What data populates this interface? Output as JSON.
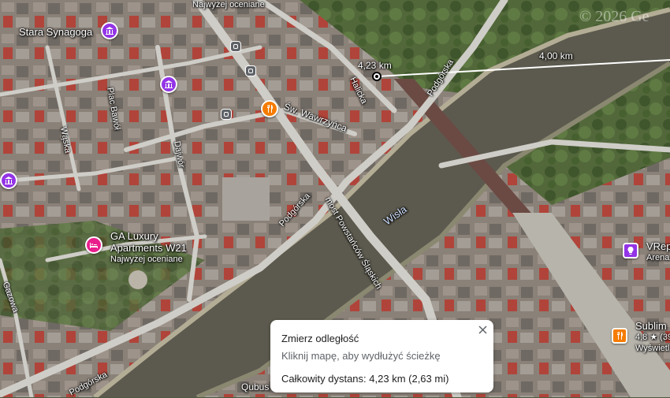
{
  "map": {
    "copyright": "© 2026 Ge",
    "river_label": "Wisła",
    "streets": {
      "halicka": "Halicka",
      "podgorska_top": "Podgórska",
      "podgorska_mid": "Podgórska",
      "podgorska_bottom": "Podgórska",
      "wawrzynca": "Św. Wawrzyńca",
      "most": "most Powstańców Śląskich",
      "plac_bawol": "Plac Bawół",
      "waska": "Wąska",
      "dajwor": "Dajwór",
      "gazowa": "Gazowa",
      "qubus": "Qubus"
    },
    "places": {
      "stara_synagoga": "Stara Synagoga",
      "top_rating": "Najwyżej oceniane",
      "ga_luxury_line1": "GA Luxury",
      "ga_luxury_line2": "Apartments W21",
      "ga_luxury_sub": "Najwyżej oceniane",
      "vrep": "VRep",
      "vrep_sub": "Arena",
      "sublim": "Sublim",
      "sublim_rating": "4,8 ★ (39",
      "sublim_sub": "Wyświetl"
    },
    "measure_labels": {
      "segment_label": "4,23 km",
      "line_label": "4,00 km"
    }
  },
  "measure_panel": {
    "title": "Zmierz odległość",
    "hint": "Kliknij mapę, aby wydłużyć ścieżkę",
    "total_label": "Całkowity dystans:",
    "total_value": "4,23 km (2,63 mi)"
  },
  "colors": {
    "river": "#5c5a4e",
    "poi_purple": "#9334e6",
    "poi_orange": "#f57c00",
    "poi_pink": "#e91e8c"
  }
}
